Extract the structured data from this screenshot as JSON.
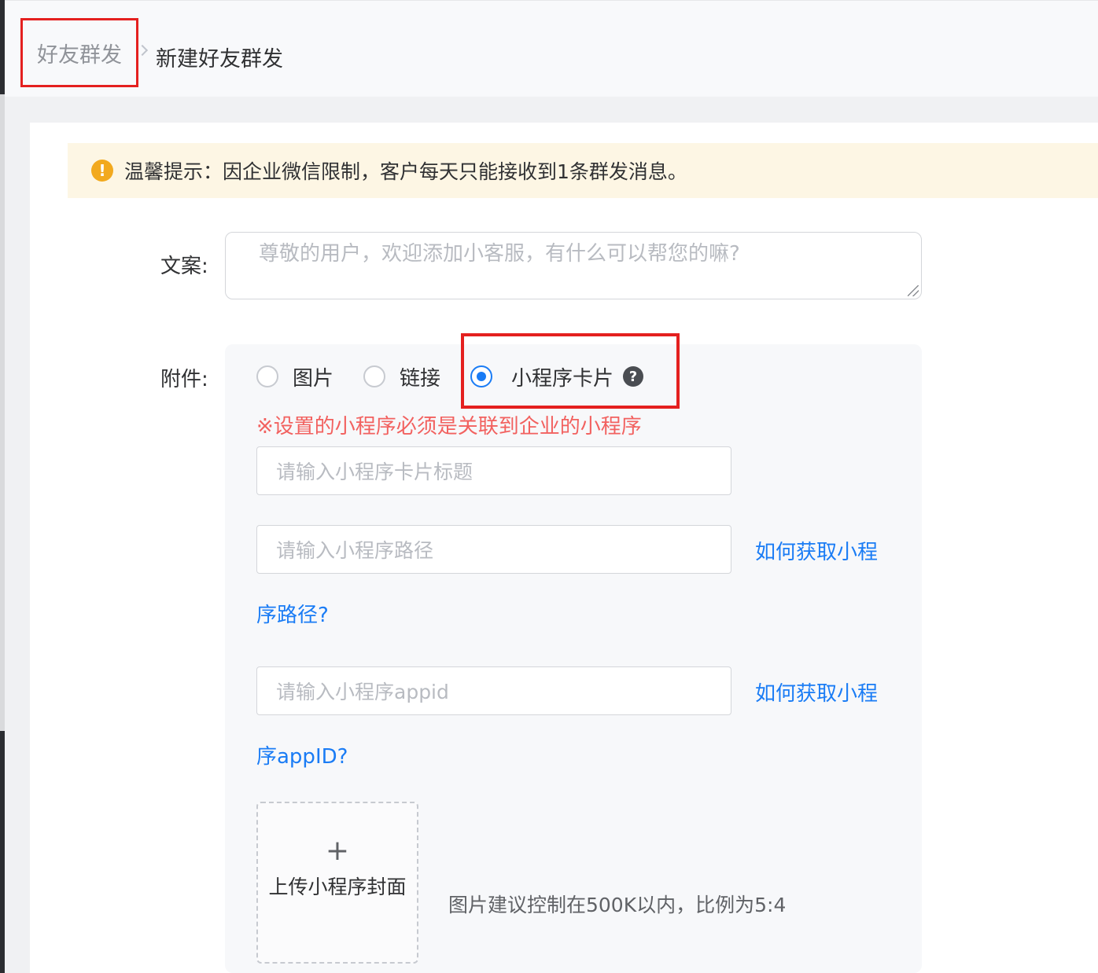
{
  "breadcrumb": {
    "parent": "好友群发",
    "current": "新建好友群发"
  },
  "alert": {
    "text": "温馨提示：因企业微信限制，客户每天只能接收到1条群发消息。"
  },
  "form": {
    "copy_label": "文案:",
    "copy_placeholder": "尊敬的用户，欢迎添加小客服，有什么可以帮您的嘛?",
    "attach_label": "附件:",
    "options": [
      {
        "label": "图片",
        "checked": false
      },
      {
        "label": "链接",
        "checked": false
      },
      {
        "label": "小程序卡片",
        "checked": true
      }
    ],
    "mini_note": "※设置的小程序必须是关联到企业的小程序",
    "title_placeholder": "请输入小程序卡片标题",
    "path_placeholder": "请输入小程序路径",
    "path_help_line1": "如何获取小程",
    "path_help_line2": "序路径?",
    "appid_placeholder": "请输入小程序appid",
    "appid_help_line1": "如何获取小程",
    "appid_help_line2": "序appID?",
    "upload_plus": "+",
    "upload_label": "上传小程序封面",
    "upload_hint": "图片建议控制在500K以内，比例为5:4"
  },
  "colors": {
    "accent": "#1a7cf5",
    "highlight": "#e4201f",
    "warning": "#f2a91e"
  }
}
